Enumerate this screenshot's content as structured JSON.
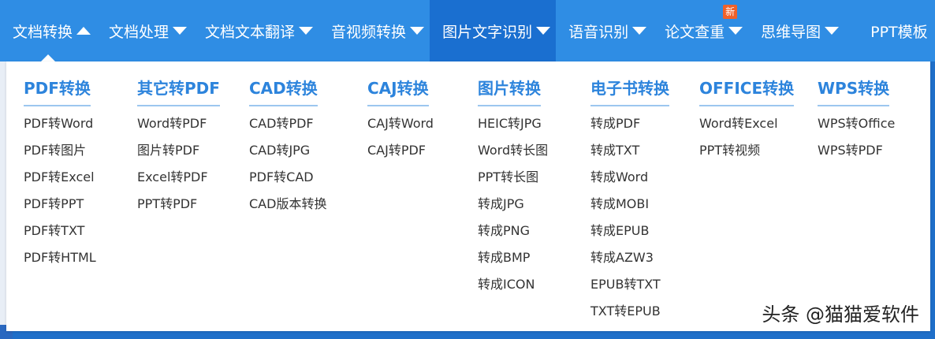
{
  "nav": {
    "items": [
      {
        "label": "文档转换",
        "caret": "up",
        "active": true
      },
      {
        "label": "文档处理",
        "caret": "down"
      },
      {
        "label": "文档文本翻译",
        "caret": "down"
      },
      {
        "label": "音视频转换",
        "caret": "down"
      },
      {
        "label": "图片文字识别",
        "caret": "down",
        "highlight": true
      },
      {
        "label": "语音识别",
        "caret": "down"
      },
      {
        "label": "论文查重",
        "caret": "down",
        "badge": "新"
      },
      {
        "label": "思维导图",
        "caret": "down"
      },
      {
        "label": "PPT模板",
        "caret": "none"
      }
    ]
  },
  "dropdown": {
    "columns": [
      {
        "title": "PDF转换",
        "items": [
          "PDF转Word",
          "PDF转图片",
          "PDF转Excel",
          "PDF转PPT",
          "PDF转TXT",
          "PDF转HTML"
        ]
      },
      {
        "title": "其它转PDF",
        "items": [
          "Word转PDF",
          "图片转PDF",
          "Excel转PDF",
          "PPT转PDF"
        ]
      },
      {
        "title": "CAD转换",
        "items": [
          "CAD转PDF",
          "CAD转JPG",
          "PDF转CAD",
          "CAD版本转换"
        ]
      },
      {
        "title": "CAJ转换",
        "items": [
          "CAJ转Word",
          "CAJ转PDF"
        ]
      },
      {
        "title": "图片转换",
        "items": [
          "HEIC转JPG",
          "Word转长图",
          "PPT转长图",
          "转成JPG",
          "转成PNG",
          "转成BMP",
          "转成ICON"
        ]
      },
      {
        "title": "电子书转换",
        "items": [
          "转成PDF",
          "转成TXT",
          "转成Word",
          "转成MOBI",
          "转成EPUB",
          "转成AZW3",
          "EPUB转TXT",
          "TXT转EPUB"
        ]
      },
      {
        "title": "OFFICE转换",
        "items": [
          "Word转Excel",
          "PPT转视频"
        ]
      },
      {
        "title": "WPS转换",
        "items": [
          "WPS转Office",
          "WPS转PDF"
        ]
      }
    ]
  },
  "watermark": "头条 @猫猫爱软件",
  "colors": {
    "nav_bg": "#2f8de4",
    "nav_active": "#1a6fd0",
    "title": "#2d84dc",
    "badge": "#f0612a"
  }
}
